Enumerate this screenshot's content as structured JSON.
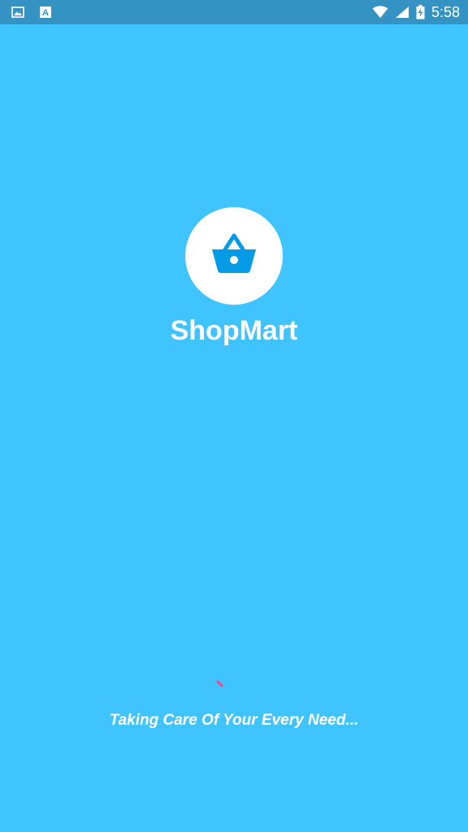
{
  "status_bar": {
    "time": "5:58",
    "left_icons": [
      "image-notification-icon",
      "text-notification-icon"
    ],
    "right_icons": [
      "wifi-icon",
      "cellular-signal-icon",
      "battery-charging-icon"
    ]
  },
  "splash": {
    "app_name": "ShopMart",
    "logo_icon": "shopping-basket-icon",
    "tagline": "Taking Care Of Your Every Need...",
    "loading_indicator": "progress-spinner"
  },
  "colors": {
    "background": "#40c4ff",
    "status_bar": "#3593c4",
    "logo_circle": "#ffffff",
    "logo_icon": "#039be5",
    "spinner_accent": "#ff4081",
    "text": "#ffffff"
  }
}
